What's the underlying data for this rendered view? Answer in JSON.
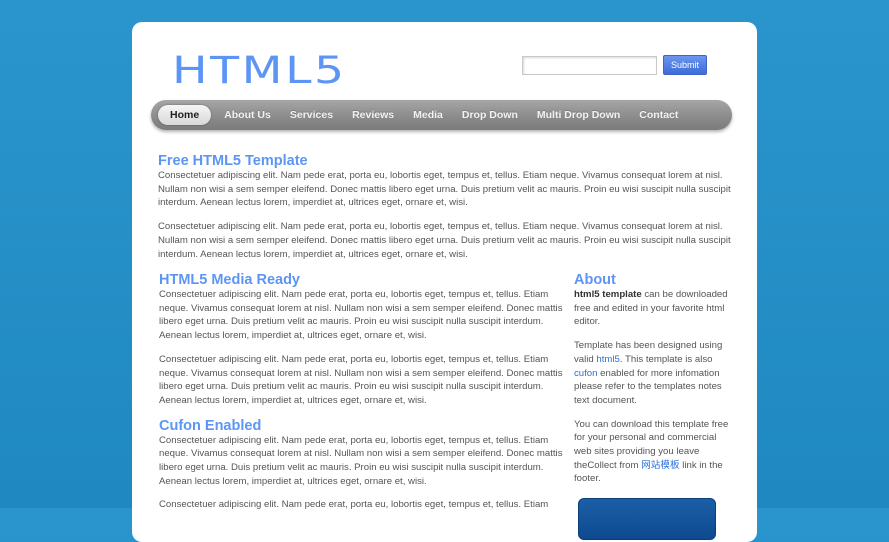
{
  "header": {
    "logo": "HTML5",
    "search": {
      "value": "",
      "placeholder": "",
      "submit_label": "Submit"
    }
  },
  "menu": {
    "items": [
      {
        "label": "Home",
        "active": true
      },
      {
        "label": "About Us"
      },
      {
        "label": "Services"
      },
      {
        "label": "Reviews"
      },
      {
        "label": "Media"
      },
      {
        "label": "Drop Down"
      },
      {
        "label": "Multi Drop Down"
      },
      {
        "label": "Contact"
      }
    ]
  },
  "intro": {
    "title": "Free HTML5 Template",
    "paragraphs": [
      "Consectetuer adipiscing elit. Nam pede erat, porta eu, lobortis eget, tempus et, tellus. Etiam neque. Vivamus consequat lorem at nisl. Nullam non wisi a sem semper eleifend. Donec mattis libero eget urna. Duis pretium velit ac mauris. Proin eu wisi suscipit nulla suscipit interdum. Aenean lectus lorem, imperdiet at, ultrices eget, ornare et, wisi.",
      "Consectetuer adipiscing elit. Nam pede erat, porta eu, lobortis eget, tempus et, tellus. Etiam neque. Vivamus consequat lorem at nisl. Nullam non wisi a sem semper eleifend. Donec mattis libero eget urna. Duis pretium velit ac mauris. Proin eu wisi suscipit nulla suscipit interdum. Aenean lectus lorem, imperdiet at, ultrices eget, ornare et, wisi."
    ]
  },
  "sections": [
    {
      "title": "HTML5 Media Ready",
      "paragraphs": [
        "Consectetuer adipiscing elit. Nam pede erat, porta eu, lobortis eget, tempus et, tellus. Etiam neque. Vivamus consequat lorem at nisl. Nullam non wisi a sem semper eleifend. Donec mattis libero eget urna. Duis pretium velit ac mauris. Proin eu wisi suscipit nulla suscipit interdum. Aenean lectus lorem, imperdiet at, ultrices eget, ornare et, wisi.",
        "Consectetuer adipiscing elit. Nam pede erat, porta eu, lobortis eget, tempus et, tellus. Etiam neque. Vivamus consequat lorem at nisl. Nullam non wisi a sem semper eleifend. Donec mattis libero eget urna. Duis pretium velit ac mauris. Proin eu wisi suscipit nulla suscipit interdum. Aenean lectus lorem, imperdiet at, ultrices eget, ornare et, wisi."
      ]
    },
    {
      "title": "Cufon Enabled",
      "paragraphs": [
        "Consectetuer adipiscing elit. Nam pede erat, porta eu, lobortis eget, tempus et, tellus. Etiam neque. Vivamus consequat lorem at nisl. Nullam non wisi a sem semper eleifend. Donec mattis libero eget urna. Duis pretium velit ac mauris. Proin eu wisi suscipit nulla suscipit interdum. Aenean lectus lorem, imperdiet at, ultrices eget, ornare et, wisi.",
        "Consectetuer adipiscing elit. Nam pede erat, porta eu, lobortis eget, tempus et, tellus. Etiam"
      ]
    }
  ],
  "sidebar": {
    "title": "About",
    "p1": {
      "bold": "html5 template",
      "rest": " can be downloaded free and edited in your favorite html editor."
    },
    "p2": {
      "t1": "Template has been designed using valid ",
      "link1": "html5",
      "t2": ". This template is also ",
      "link2": "cufon",
      "t3": " enabled for more infomation please refer to the templates notes text document."
    },
    "p3": {
      "t1": "You can download this template free for your personal and commercial web sites providing you leave theCollect from ",
      "link": "网站模板",
      "t2": " link in the footer."
    }
  },
  "colors": {
    "background": "#2a95cc",
    "accent": "#5d95f5",
    "link": "#2a6fd6",
    "text": "#555555",
    "menu": "#8c8c8c"
  }
}
